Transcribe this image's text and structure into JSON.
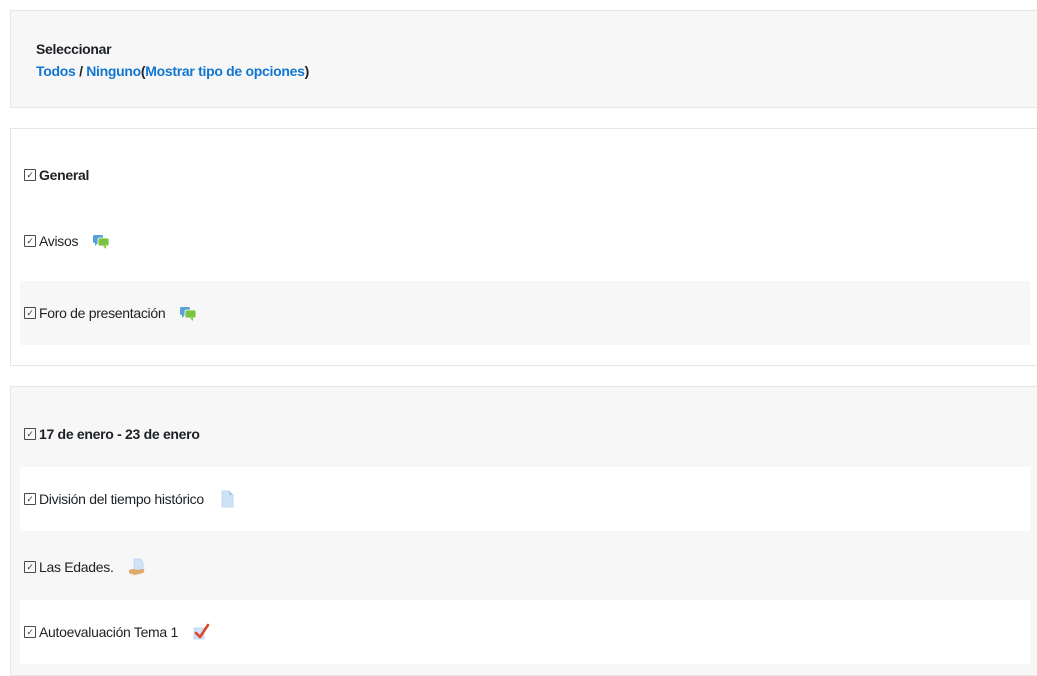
{
  "selector": {
    "title": "Seleccionar",
    "all_link": "Todos",
    "separator": "/",
    "none_link": "Ninguno",
    "open_paren": "(",
    "options_link": "Mostrar tipo de opciones",
    "close_paren": ")"
  },
  "check_glyph": "✓",
  "sections": [
    {
      "title": "General",
      "items": [
        {
          "label": "Avisos",
          "icon": "forum-icon"
        },
        {
          "label": "Foro de presentación",
          "icon": "forum-icon"
        }
      ]
    },
    {
      "title": "17 de enero - 23 de enero",
      "items": [
        {
          "label": "División del tiempo histórico",
          "icon": "page-icon"
        },
        {
          "label": "Las Edades.",
          "icon": "resource-icon"
        },
        {
          "label": "Autoevaluación Tema 1",
          "icon": "quiz-icon"
        }
      ]
    }
  ],
  "colors": {
    "link": "#1177d1",
    "panel_grey": "#f7f7f7",
    "forum_blue": "#5aa0d8",
    "forum_green": "#7cc242",
    "page_blue": "#cfe3f6",
    "quiz_red": "#e0452c"
  }
}
